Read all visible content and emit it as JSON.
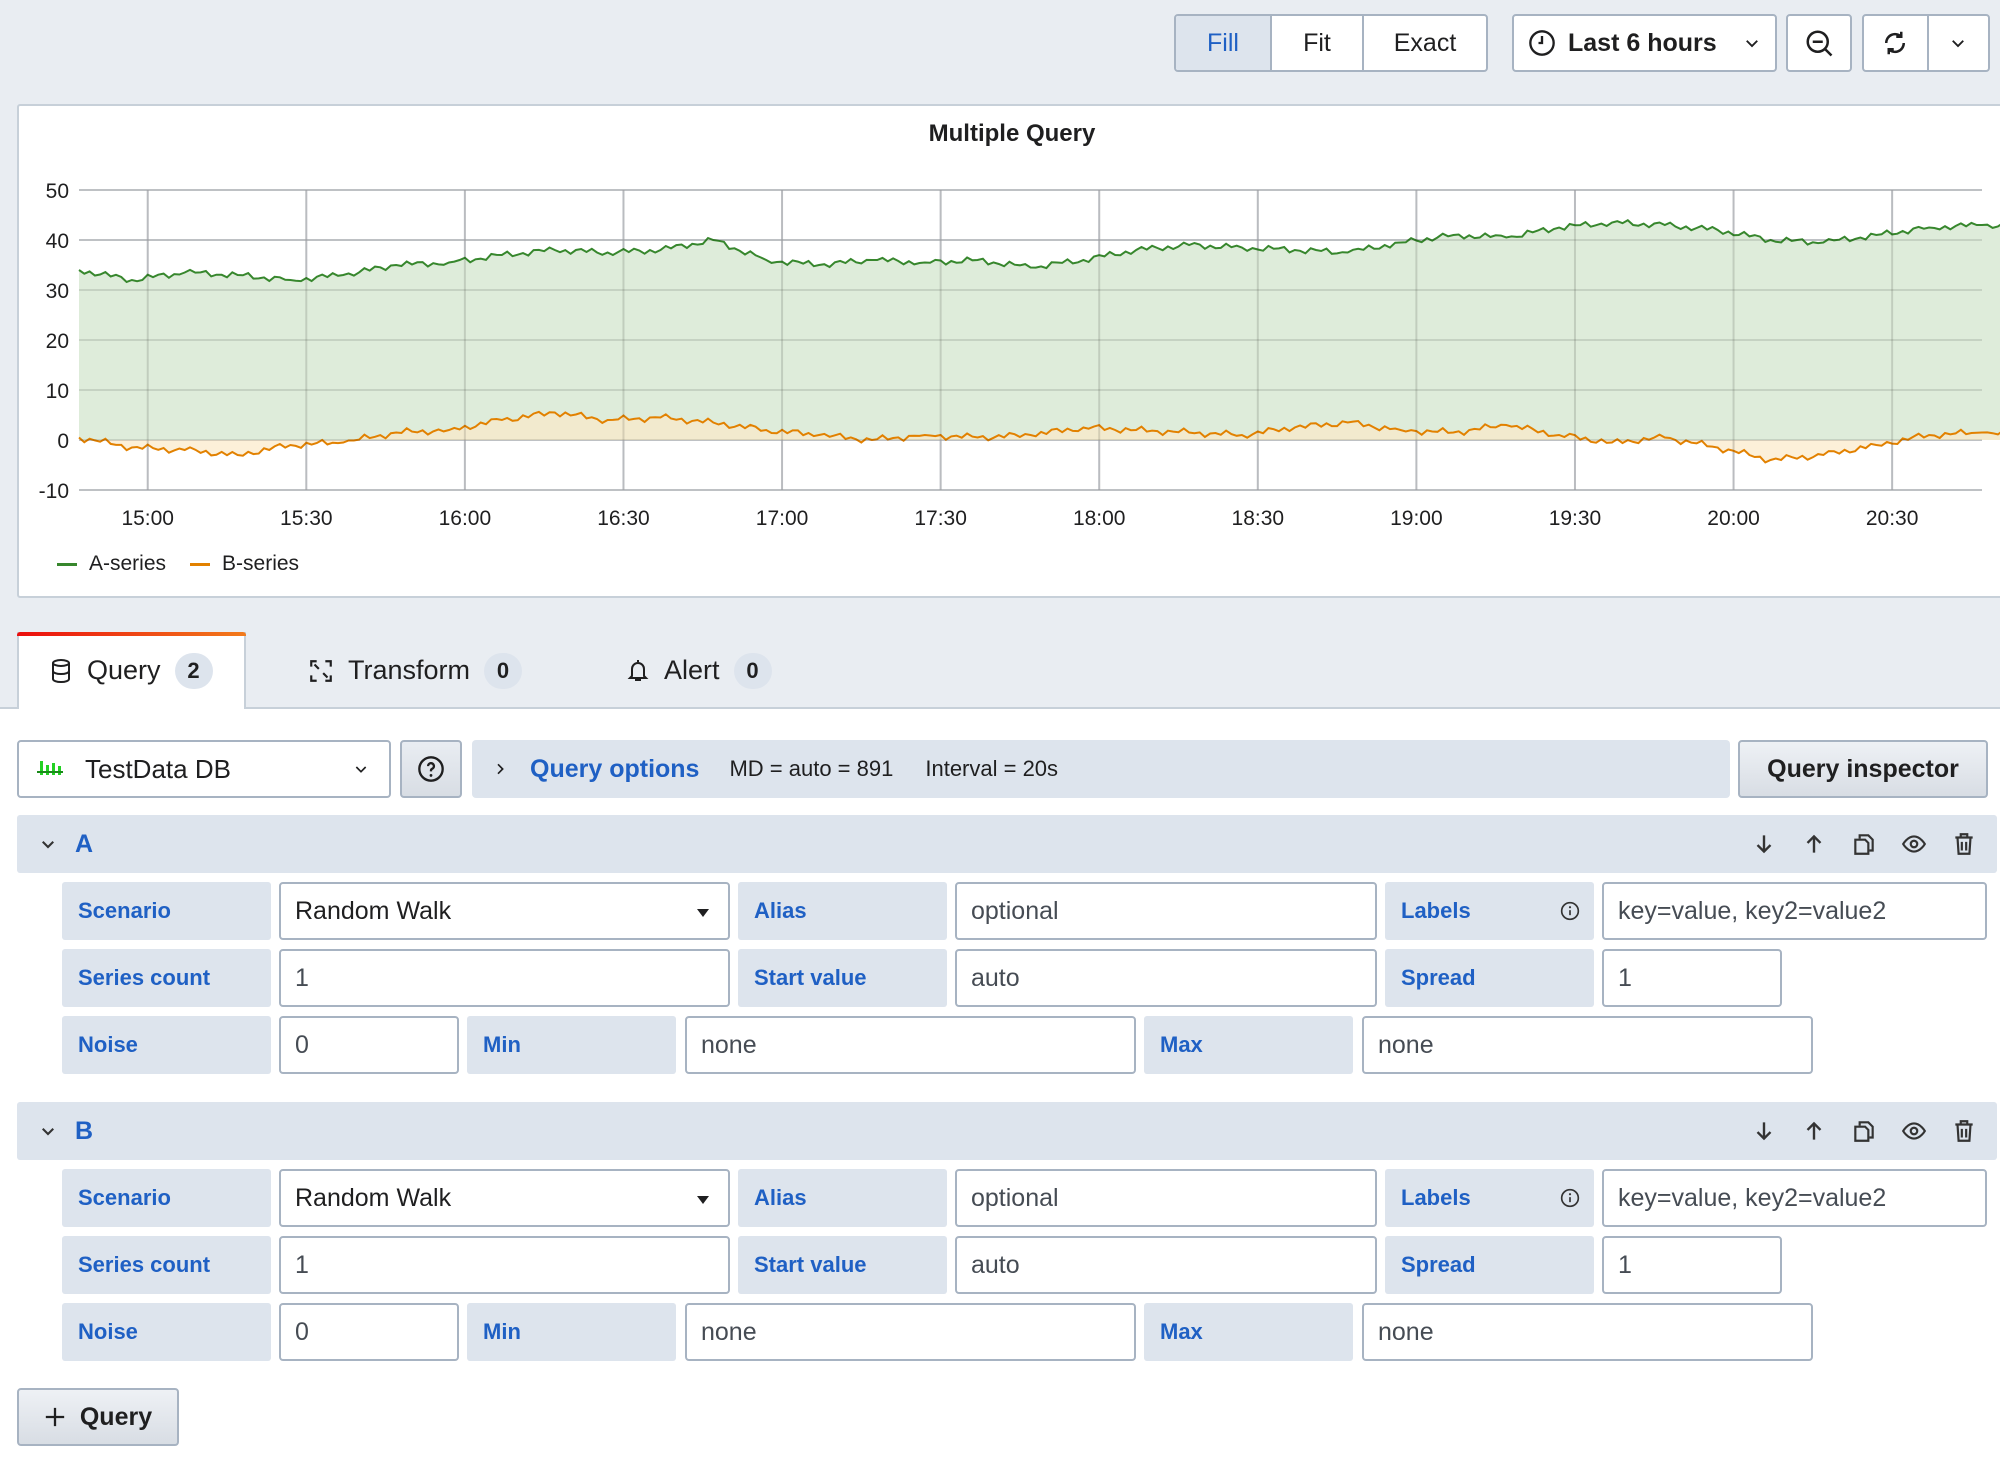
{
  "toolbar": {
    "display_modes": [
      {
        "label": "Fill",
        "active": true
      },
      {
        "label": "Fit",
        "active": false
      },
      {
        "label": "Exact",
        "active": false
      }
    ],
    "time_range": "Last 6 hours",
    "icons": {
      "time": "clock-icon",
      "zoom_out": "zoom-out-icon",
      "refresh": "refresh-icon",
      "refresh_menu": "chevron-down-icon"
    }
  },
  "chart_data": {
    "type": "area",
    "title": "Multiple Query",
    "xlabel": "",
    "ylabel": "",
    "ylim": [
      -10,
      50
    ],
    "yticks": [
      50,
      40,
      30,
      20,
      10,
      0,
      -10
    ],
    "x_start": "14:47",
    "x_end": "20:47",
    "x_step_minutes": 10,
    "xticks": [
      "15:00",
      "15:30",
      "16:00",
      "16:30",
      "17:00",
      "17:30",
      "18:00",
      "18:30",
      "19:00",
      "19:30",
      "20:00",
      "20:30"
    ],
    "grid": true,
    "legend_position": "bottom-left",
    "series": [
      {
        "name": "A-series",
        "color": "#37872d",
        "fill": "#dcebd8",
        "values": [
          34,
          32,
          33.5,
          33,
          32,
          33,
          35,
          35.5,
          37,
          38,
          37.5,
          38,
          40,
          36,
          35,
          36,
          35.5,
          36,
          34.5,
          36,
          38,
          39,
          38.5,
          38,
          37.5,
          39.5,
          41,
          40.5,
          42.5,
          43.5,
          43,
          42,
          40,
          39.5,
          41,
          42.5,
          43,
          42.5
        ]
      },
      {
        "name": "B-series",
        "color": "#e28100",
        "fill": "#fbe9c9",
        "values": [
          0.5,
          -1.5,
          -2,
          -3,
          -1,
          -0.5,
          1.5,
          2,
          4,
          5.5,
          4,
          4.5,
          3.5,
          2,
          1,
          0,
          1,
          0.5,
          1,
          2.5,
          2,
          1.5,
          1,
          2.5,
          3.5,
          2,
          1.5,
          3,
          1,
          -0.5,
          0.5,
          -1.5,
          -4,
          -3,
          -1,
          1,
          1.5,
          0.5
        ]
      }
    ]
  },
  "tabs": [
    {
      "label": "Query",
      "count": "2",
      "icon": "database-icon",
      "active": true
    },
    {
      "label": "Transform",
      "count": "0",
      "icon": "transform-icon",
      "active": false
    },
    {
      "label": "Alert",
      "count": "0",
      "icon": "bell-icon",
      "active": false
    }
  ],
  "datasource": {
    "name": "TestData DB",
    "color": "#24d124"
  },
  "query_options": {
    "label": "Query options",
    "max_data_points": "MD = auto = 891",
    "interval": "Interval = 20s"
  },
  "query_inspector_label": "Query inspector",
  "queries": [
    {
      "ref": "A",
      "fields": {
        "scenario_label": "Scenario",
        "scenario_value": "Random Walk",
        "alias_label": "Alias",
        "alias_placeholder": "optional",
        "labels_label": "Labels",
        "labels_placeholder": "key=value, key2=value2",
        "series_count_label": "Series count",
        "series_count_value": "1",
        "start_value_label": "Start value",
        "start_value_placeholder": "auto",
        "spread_label": "Spread",
        "spread_value": "1",
        "noise_label": "Noise",
        "noise_value": "0",
        "min_label": "Min",
        "min_placeholder": "none",
        "max_label": "Max",
        "max_placeholder": "none"
      }
    },
    {
      "ref": "B",
      "fields": {
        "scenario_label": "Scenario",
        "scenario_value": "Random Walk",
        "alias_label": "Alias",
        "alias_placeholder": "optional",
        "labels_label": "Labels",
        "labels_placeholder": "key=value, key2=value2",
        "series_count_label": "Series count",
        "series_count_value": "1",
        "start_value_label": "Start value",
        "start_value_placeholder": "auto",
        "spread_label": "Spread",
        "spread_value": "1",
        "noise_label": "Noise",
        "noise_value": "0",
        "min_label": "Min",
        "min_placeholder": "none",
        "max_label": "Max",
        "max_placeholder": "none"
      }
    }
  ],
  "add_query_label": "Query"
}
